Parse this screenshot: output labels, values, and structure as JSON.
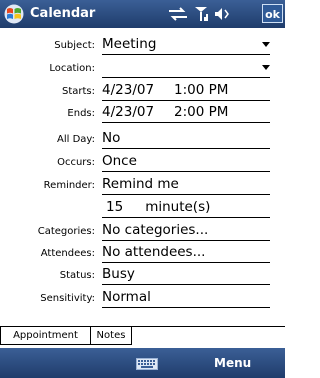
{
  "titlebar": {
    "app_title": "Calendar",
    "ok_label": "ok",
    "icons": [
      "windows-start-icon",
      "connectivity-icon",
      "signal-icon",
      "volume-icon"
    ]
  },
  "form": {
    "subject": {
      "label": "Subject:",
      "value": "Meeting"
    },
    "location": {
      "label": "Location:",
      "value": ""
    },
    "starts": {
      "label": "Starts:",
      "date": "4/23/07",
      "time": "1:00 PM"
    },
    "ends": {
      "label": "Ends:",
      "date": "4/23/07",
      "time": "2:00 PM"
    },
    "all_day": {
      "label": "All Day:",
      "value": "No"
    },
    "occurs": {
      "label": "Occurs:",
      "value": "Once"
    },
    "reminder": {
      "label": "Reminder:",
      "value": "Remind me",
      "amount": "15",
      "unit": "minute(s)"
    },
    "categories": {
      "label": "Categories:",
      "value": "No categories..."
    },
    "attendees": {
      "label": "Attendees:",
      "value": "No attendees..."
    },
    "status": {
      "label": "Status:",
      "value": "Busy"
    },
    "sensitivity": {
      "label": "Sensitivity:",
      "value": "Normal"
    }
  },
  "tabs": [
    {
      "label": "Appointment",
      "active": true
    },
    {
      "label": "Notes",
      "active": false
    }
  ],
  "softbar": {
    "menu_label": "Menu",
    "keyboard_icon": "keyboard-icon"
  },
  "colors": {
    "bar_top": "#3b5f96",
    "bar_bottom": "#1f3c6b"
  }
}
